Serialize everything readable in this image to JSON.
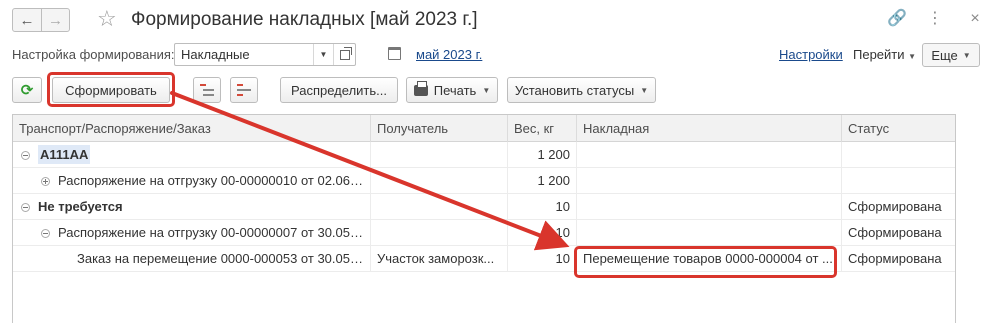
{
  "title_bar": {
    "back_icon": "arrow-left-icon",
    "forward_icon": "arrow-right-icon",
    "favorite_icon": "star-icon",
    "title": "Формирование накладных [май 2023 г.]",
    "icons": [
      "link-icon",
      "more-vertical-icon",
      "close-icon"
    ]
  },
  "settings_row": {
    "label": "Настройка формирования:",
    "select_value": "Накладные",
    "period": "май 2023 г.",
    "settings_link": "Настройки",
    "goto_menu": "Перейти",
    "more_button": "Еще"
  },
  "toolbar": {
    "refresh_icon": "refresh-icon",
    "form_button": "Сформировать",
    "distribute_button": "Распределить...",
    "print_button": "Печать",
    "set_status_button": "Установить статусы"
  },
  "table": {
    "columns": [
      "Транспорт/Распоряжение/Заказ",
      "Получатель",
      "Вес, кг",
      "Накладная",
      "Статус"
    ],
    "rows": [
      {
        "name": "А111АА",
        "recipient": "",
        "weight": "1 200",
        "invoice": "",
        "status": ""
      },
      {
        "name": "Распоряжение на отгрузку 00-00000010 от 02.06....",
        "recipient": "",
        "weight": "1 200",
        "invoice": "",
        "status": ""
      },
      {
        "name": "Не требуется",
        "recipient": "",
        "weight": "10",
        "invoice": "",
        "status": "Сформирована"
      },
      {
        "name": "Распоряжение на отгрузку 00-00000007 от 30.05....",
        "recipient": "",
        "weight": "10",
        "invoice": "",
        "status": "Сформирована"
      },
      {
        "name": "Заказ на перемещение 0000-000053 от 30.05....",
        "recipient": "Участок заморозк...",
        "weight": "10",
        "invoice": "Перемещение товаров 0000-000004 от ...",
        "status": "Сформирована"
      }
    ]
  },
  "annotation_color": "#d9352c"
}
